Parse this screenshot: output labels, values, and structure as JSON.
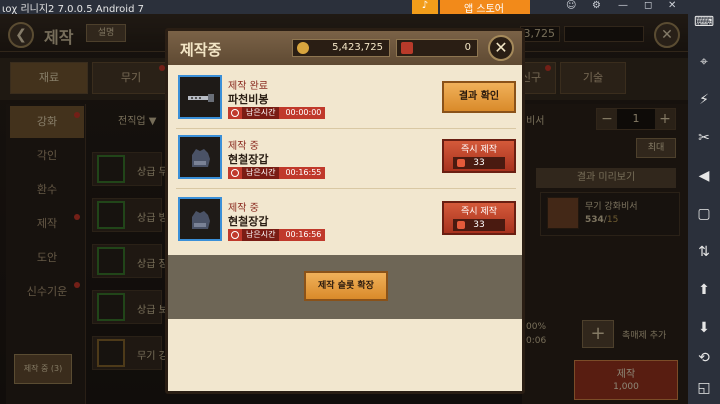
{
  "emulator": {
    "title": "ιοχ 리니지2 7.0.0.5   Android 7",
    "orange_badge": "♪",
    "store_label": "앱 스토어",
    "window_controls": [
      "☺",
      "⚙",
      "—",
      "◻",
      "✕"
    ],
    "side_icons": [
      "⌨",
      "⌖",
      "⚡",
      "✂",
      "◀",
      "▢",
      "⇅",
      "⬆",
      "⬇",
      "⟲",
      "◱"
    ]
  },
  "topbar": {
    "back_icon": "❮",
    "title": "제작",
    "help_label": "설명",
    "currency_right_1": "3,725",
    "close_icon": "✕"
  },
  "tabs": [
    {
      "label": "재료",
      "active": true,
      "dot": false
    },
    {
      "label": "무기",
      "active": false,
      "dot": true
    },
    {
      "label": "장신구",
      "active": false,
      "dot": true
    },
    {
      "label": "기술",
      "active": false,
      "dot": false
    }
  ],
  "leftnav": {
    "items": [
      {
        "label": "강화",
        "active": true,
        "dot": true
      },
      {
        "label": "각인",
        "active": false,
        "dot": false
      },
      {
        "label": "환수",
        "active": false,
        "dot": false
      },
      {
        "label": "제작",
        "active": false,
        "dot": true
      },
      {
        "label": "도안",
        "active": false,
        "dot": false
      },
      {
        "label": "신수기운",
        "active": false,
        "dot": true
      }
    ],
    "crafting_button": "제작 중 (3)"
  },
  "list": {
    "header": "전직업 ▼",
    "items": [
      {
        "name": "상급 무",
        "frame": "green"
      },
      {
        "name": "상급 방",
        "frame": "green"
      },
      {
        "name": "상급 장",
        "frame": "green"
      },
      {
        "name": "상급 보",
        "frame": "green"
      },
      {
        "name": "무기 강",
        "frame": "gold"
      }
    ]
  },
  "right": {
    "label": "비서",
    "stepper": {
      "minus": "−",
      "value": "1",
      "plus": "+"
    },
    "max_label": "최대",
    "preview_tab": "결과 미리보기",
    "book": {
      "name": "무기 강화비서",
      "count": "534",
      "required": "15"
    },
    "pct1": "00%",
    "pct2": "0:06",
    "add_catalyst_icon": "+",
    "add_catalyst_label": "촉매제 추가",
    "craft_label": "제작",
    "craft_cost": "1,000"
  },
  "modal": {
    "title": "제작중",
    "gold": "5,423,725",
    "gem": "0",
    "close_icon": "✕",
    "slots": [
      {
        "status": "제작 완료",
        "name": "파천비봉",
        "time_label": "남은시간",
        "time": "00:00:00",
        "button": "결과 확인",
        "icon": "dagger-icon",
        "type": "done"
      },
      {
        "status": "제작 중",
        "name": "현철장갑",
        "time_label": "남은시간",
        "time": "00:16:55",
        "button": "즉시 제작",
        "cost": "33",
        "icon": "gauntlet-icon",
        "type": "progress"
      },
      {
        "status": "제작 중",
        "name": "현철장갑",
        "time_label": "남은시간",
        "time": "00:16:56",
        "button": "즉시 제작",
        "cost": "33",
        "icon": "gauntlet-icon",
        "type": "progress"
      }
    ],
    "expand_label": "제작 슬롯 확장"
  },
  "colors": {
    "accent_orange": "#d98a2a",
    "accent_red": "#a8321e",
    "slot_frame_blue": "#3a8fd8"
  }
}
